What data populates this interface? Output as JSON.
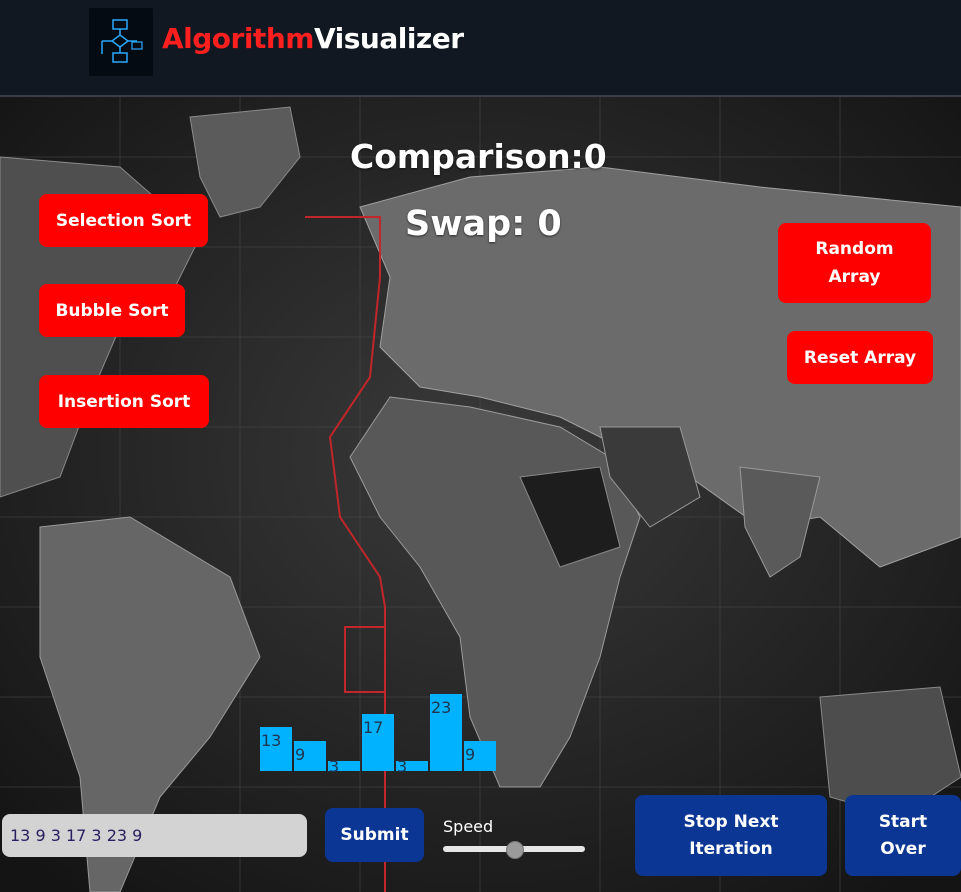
{
  "header": {
    "brand_part1": "Algorithm",
    "brand_part2": "Visualizer",
    "logo_icon": "flowchart-icon"
  },
  "stats": {
    "comparison": "Comparison:0",
    "swap": "Swap: 0"
  },
  "sort_buttons": {
    "selection": "Selection Sort",
    "bubble": "Bubble Sort",
    "insertion": "Insertion Sort"
  },
  "array_buttons": {
    "random": "Random Array",
    "reset": "Reset Array"
  },
  "array": {
    "values": [
      13,
      9,
      3,
      17,
      3,
      23,
      9
    ],
    "labels": [
      "13",
      "9",
      "3",
      "17",
      "3",
      "23",
      "9"
    ],
    "bar_color": "#00b2ff"
  },
  "controls": {
    "input_value": "13 9 3 17 3 23 9",
    "submit_label": "Submit",
    "speed_label": "Speed",
    "speed_fraction": 0.5,
    "stop_label": "Stop Next Iteration",
    "start_over_label": "Start Over"
  },
  "colors": {
    "accent_red": "#ff0000",
    "accent_blue": "#0b3694",
    "brand_red": "#ff1f1f"
  }
}
